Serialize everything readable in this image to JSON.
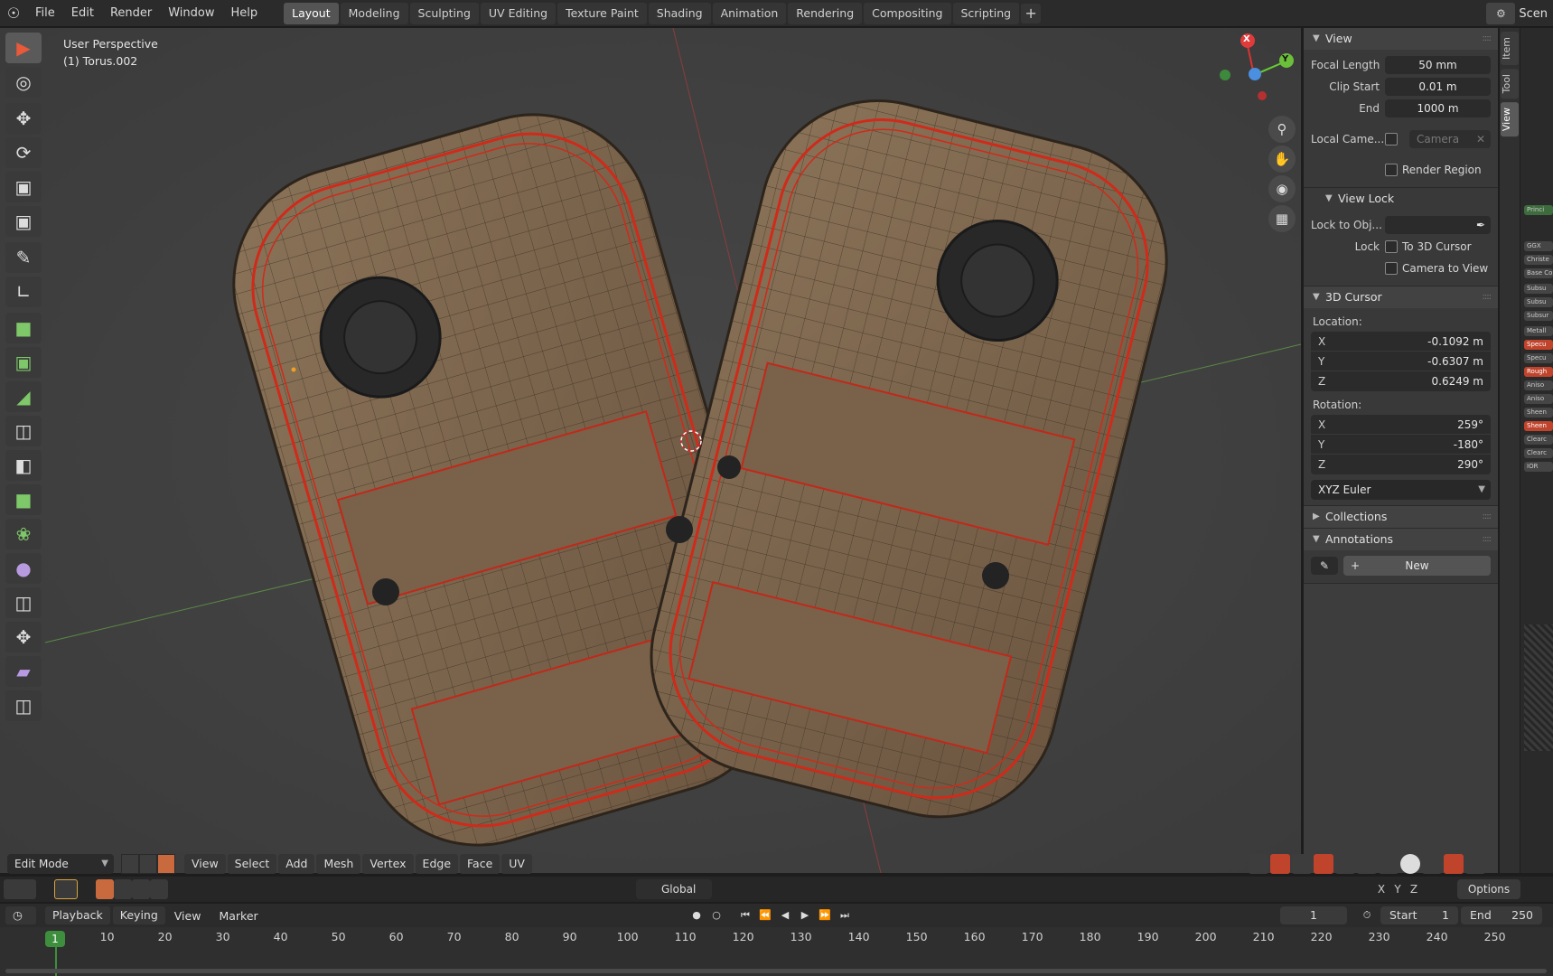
{
  "menu": [
    "File",
    "Edit",
    "Render",
    "Window",
    "Help"
  ],
  "workspaces": [
    {
      "label": "Layout",
      "active": true
    },
    {
      "label": "Modeling"
    },
    {
      "label": "Sculpting"
    },
    {
      "label": "UV Editing"
    },
    {
      "label": "Texture Paint"
    },
    {
      "label": "Shading"
    },
    {
      "label": "Animation"
    },
    {
      "label": "Rendering"
    },
    {
      "label": "Compositing"
    },
    {
      "label": "Scripting"
    }
  ],
  "workspace_add": "+",
  "scene_label": "Scen",
  "viewport": {
    "perspective": "User Perspective",
    "object": "(1) Torus.002",
    "gizmo": {
      "x": "X",
      "y": "Y"
    }
  },
  "npanel": {
    "view": {
      "title": "View",
      "focal_label": "Focal Length",
      "focal_value": "50 mm",
      "clip_start_label": "Clip Start",
      "clip_start_value": "0.01 m",
      "clip_end_label": "End",
      "clip_end_value": "1000 m",
      "local_camera_label": "Local Came...",
      "camera_placeholder": "Camera",
      "render_region_label": "Render Region"
    },
    "view_lock": {
      "title": "View Lock",
      "lock_to_obj_label": "Lock to Obj...",
      "lock_label": "Lock",
      "to_cursor_label": "To 3D Cursor",
      "cam_to_view_label": "Camera to View"
    },
    "cursor": {
      "title": "3D Cursor",
      "location_label": "Location:",
      "loc_x": "-0.1092 m",
      "loc_y": "-0.6307 m",
      "loc_z": "0.6249 m",
      "rotation_label": "Rotation:",
      "rot_x": "259°",
      "rot_y": "-180°",
      "rot_z": "290°",
      "mode": "XYZ Euler"
    },
    "collections_title": "Collections",
    "annotations_title": "Annotations",
    "new_label": "New"
  },
  "vtabs": [
    "Item",
    "Tool",
    "View"
  ],
  "right_strip": [
    "Princi",
    "GGX",
    "Christe",
    "Base Co",
    "Subsu",
    "Subsu",
    "Subsur",
    "Metall",
    "Specu",
    "Specu",
    "Rough",
    "Aniso",
    "Aniso",
    "Sheen",
    "Sheen",
    "Clearc",
    "Clearc",
    "IOR"
  ],
  "header": {
    "mode": "Edit Mode",
    "menus": [
      "View",
      "Select",
      "Add",
      "Mesh",
      "Vertex",
      "Edge",
      "Face",
      "UV"
    ]
  },
  "toolsettings": {
    "orientation": "Global",
    "options": "Options",
    "axes": [
      "X",
      "Y",
      "Z"
    ]
  },
  "timeline": {
    "playback": "Playback",
    "keying": "Keying",
    "view": "View",
    "marker": "Marker",
    "current_frame": "1",
    "start_label": "Start",
    "start_value": "1",
    "end_label": "End",
    "end_value": "250",
    "playhead": "1",
    "ticks": [
      "10",
      "20",
      "30",
      "40",
      "50",
      "60",
      "70",
      "80",
      "90",
      "100",
      "110",
      "120",
      "130",
      "140",
      "150",
      "160",
      "170",
      "180",
      "190",
      "200",
      "210",
      "220",
      "230",
      "240",
      "250"
    ]
  }
}
